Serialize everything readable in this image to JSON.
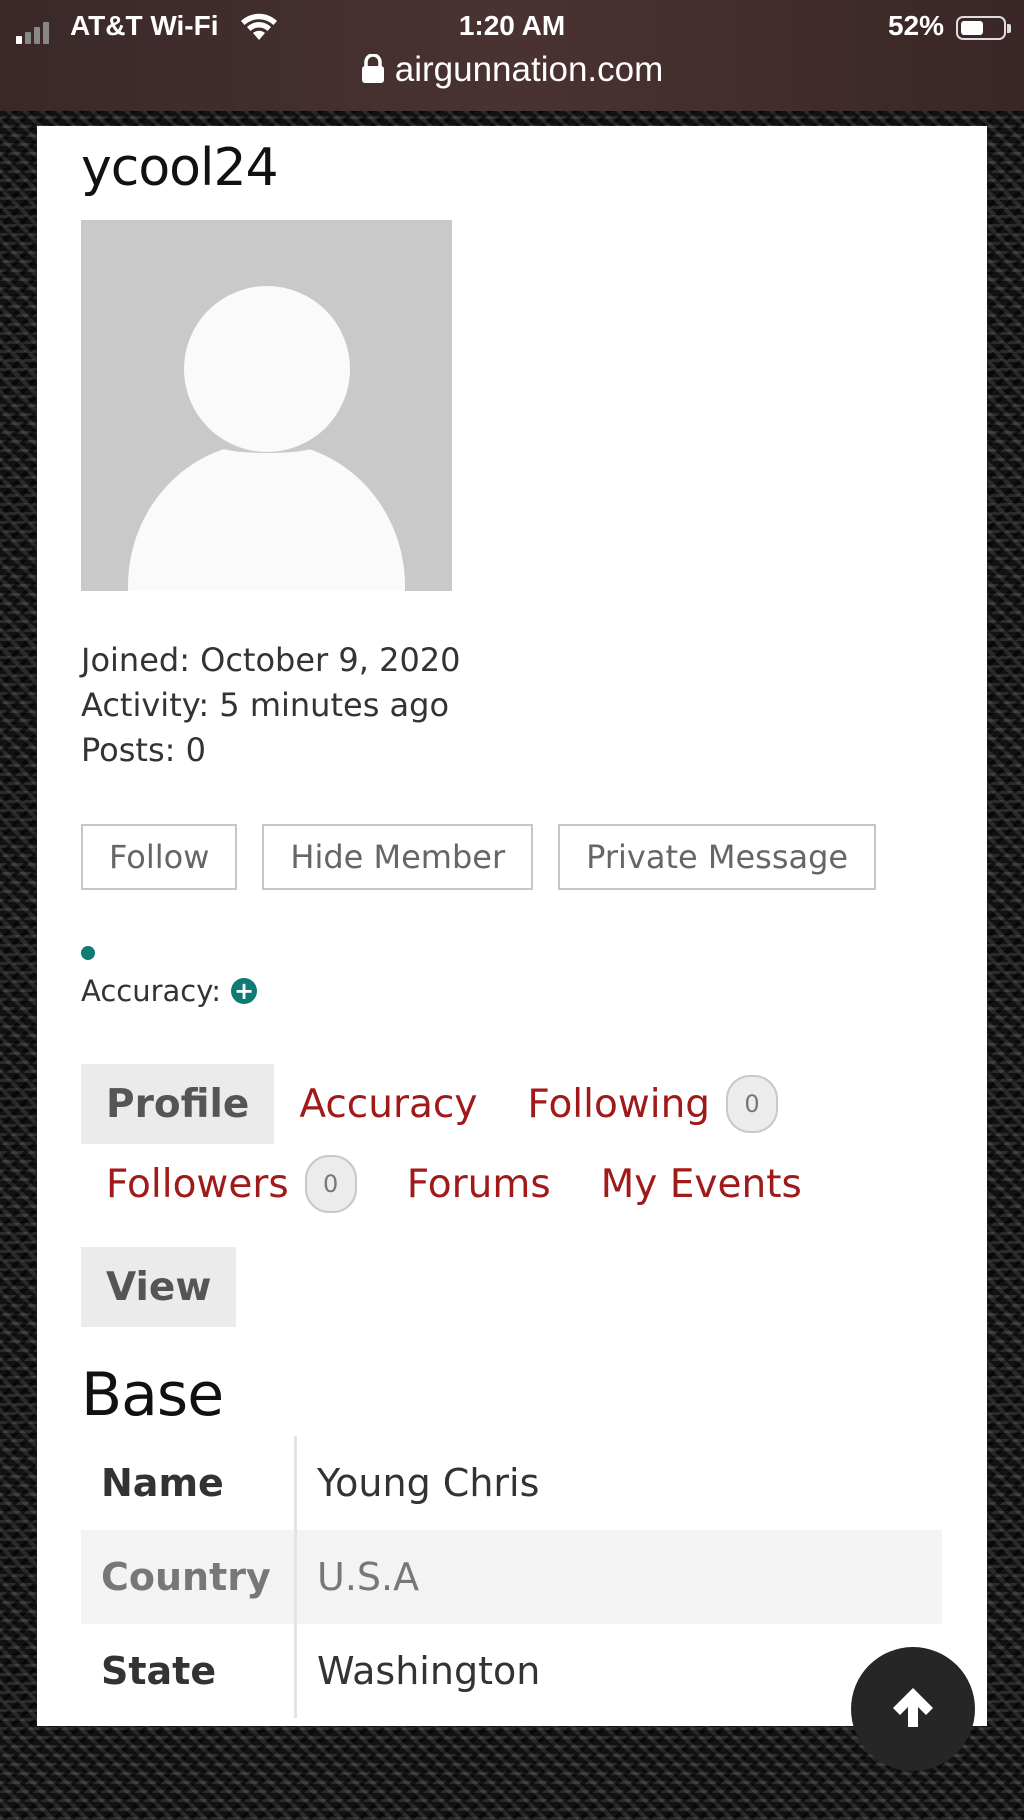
{
  "status_bar": {
    "carrier": "AT&T Wi-Fi",
    "time": "1:20 AM",
    "battery_percent": "52%",
    "battery_level": 0.52,
    "signal_bars_active": 1
  },
  "browser": {
    "url": "airgunnation.com"
  },
  "profile": {
    "username": "ycool24",
    "joined": "Joined: October 9, 2020",
    "activity": "Activity: 5 minutes ago",
    "posts": "Posts: 0",
    "accuracy_label": "Accuracy:"
  },
  "actions": {
    "follow": "Follow",
    "hide_member": "Hide Member",
    "private_message": "Private Message"
  },
  "tabs": {
    "profile": "Profile",
    "accuracy": "Accuracy",
    "following": "Following",
    "following_count": "0",
    "followers": "Followers",
    "followers_count": "0",
    "forums": "Forums",
    "my_events": "My Events"
  },
  "subtabs": {
    "view": "View"
  },
  "section": {
    "title": "Base",
    "rows": [
      {
        "label": "Name",
        "value": "Young Chris"
      },
      {
        "label": "Country",
        "value": "U.S.A"
      },
      {
        "label": "State",
        "value": "Washington"
      }
    ]
  },
  "icons": {
    "lock": "lock-icon",
    "wifi": "wifi-icon",
    "plus": "plus-circle-icon",
    "back_to_top": "arrow-up-icon"
  },
  "colors": {
    "link": "#a01a1a",
    "accent_teal": "#0e7c74"
  }
}
